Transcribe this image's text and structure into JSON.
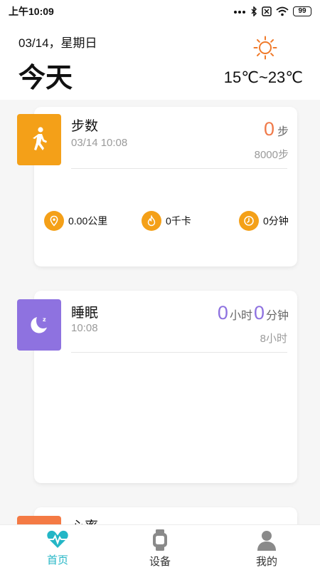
{
  "status_bar": {
    "time": "上午10:09",
    "signal_icon": "dots-signal-icon",
    "bluetooth_icon": "bluetooth-icon",
    "sim_icon": "no-sim-icon",
    "wifi_icon": "wifi-icon",
    "battery": "99"
  },
  "header": {
    "date": "03/14，星期日",
    "title": "今天",
    "weather_icon": "sun-icon",
    "temperature": "15℃~23℃"
  },
  "steps_card": {
    "title": "步数",
    "datetime": "03/14 10:08",
    "value": "0",
    "unit": "步",
    "goal": "8000步",
    "icon": "walking-icon",
    "stats": [
      {
        "icon": "location-pin-icon",
        "label": "0.00公里"
      },
      {
        "icon": "flame-icon",
        "label": "0千卡"
      },
      {
        "icon": "clock-icon",
        "label": "0分钟"
      }
    ]
  },
  "sleep_card": {
    "title": "睡眠",
    "time": "10:08",
    "hours": "0",
    "hours_unit": "小时",
    "minutes": "0",
    "minutes_unit": "分钟",
    "goal": "8小时",
    "icon": "moon-sleep-icon"
  },
  "heart_card": {
    "title": "心率",
    "icon": "heart-icon"
  },
  "bottom_nav": {
    "items": [
      {
        "label": "首页",
        "icon": "heartbeat-icon",
        "active": true
      },
      {
        "label": "设备",
        "icon": "watch-icon",
        "active": false
      },
      {
        "label": "我的",
        "icon": "person-icon",
        "active": false
      }
    ]
  },
  "colors": {
    "orange": "#f4a018",
    "purple": "#8e72e0",
    "steps_value": "#f07a4a",
    "sleep_value": "#8e72e0",
    "nav_active": "#23b6c6",
    "weather": "#f07a2a"
  }
}
